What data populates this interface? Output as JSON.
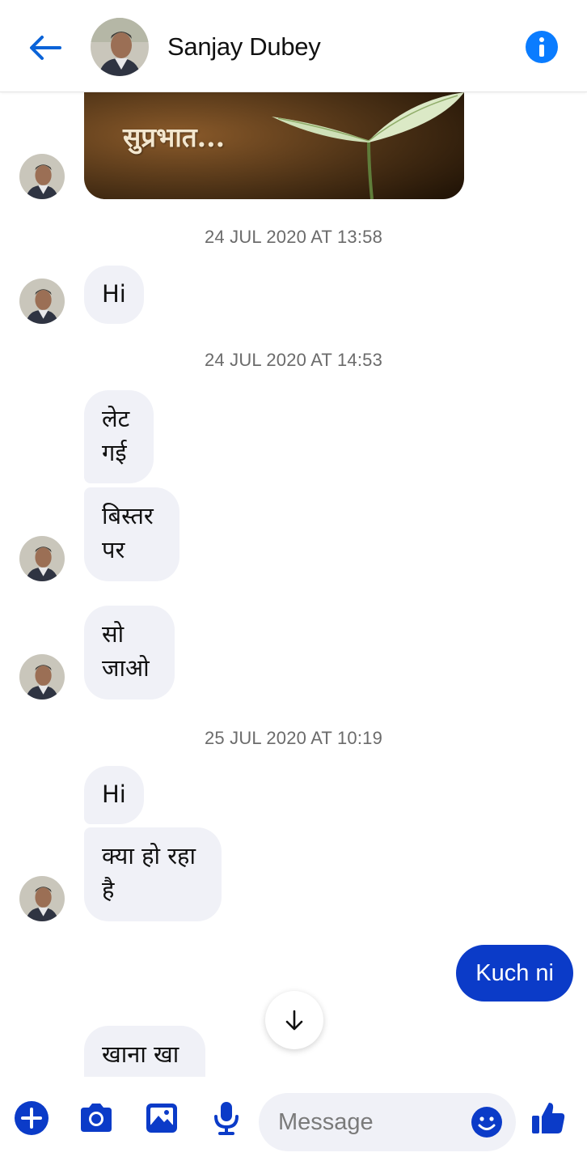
{
  "header": {
    "contact_name": "Sanjay Dubey",
    "back_icon": "arrow-left-icon",
    "info_icon": "info-icon"
  },
  "messages": {
    "image_caption": "सुप्रभात...",
    "ts1": "24 JUL 2020 AT 13:58",
    "m1": "Hi",
    "ts2": "24 JUL 2020 AT 14:53",
    "m2a_line1": "लेट",
    "m2a_line2": "गई",
    "m2b_line1": "बिस्तर",
    "m2b_line2": "पर",
    "m3_line1": "सो",
    "m3_line2": "जाओ",
    "ts3": "25 JUL 2020 AT 10:19",
    "m4": "Hi",
    "m5_line1": "क्या हो रहा",
    "m5_line2": "है",
    "sent1": "Kuch ni",
    "m6_line1": "खाना खा"
  },
  "composer": {
    "placeholder": "Message",
    "icons": [
      "plus-icon",
      "camera-icon",
      "gallery-icon",
      "microphone-icon",
      "emoji-icon",
      "thumbs-up-icon"
    ]
  },
  "colors": {
    "accent": "#0b3bc8",
    "info_blue": "#0a7cff",
    "bubble_gray": "#f0f1f7"
  }
}
